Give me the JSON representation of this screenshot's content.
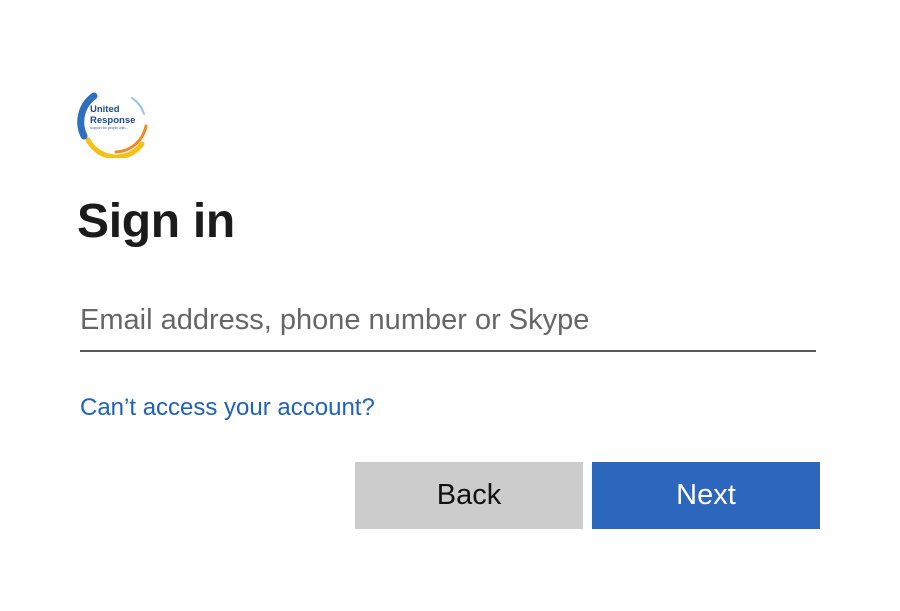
{
  "logo": {
    "line1": "United",
    "line2": "Response",
    "tagline": "support for people with...",
    "colors": {
      "ring_blue": "#2f6fc0",
      "ring_yellow": "#f2c21b",
      "ring_orange": "#f08a24",
      "text": "#1f4a8a"
    }
  },
  "title": "Sign in",
  "login_field": {
    "value": "",
    "placeholder": "Email address, phone number or Skype"
  },
  "help_link": "Can’t access your account?",
  "buttons": {
    "back": "Back",
    "next": "Next"
  },
  "colors": {
    "accent": "#2c67bd",
    "link": "#1f62b8",
    "secondary_button": "#cccccc",
    "text": "#1b1b1b"
  }
}
